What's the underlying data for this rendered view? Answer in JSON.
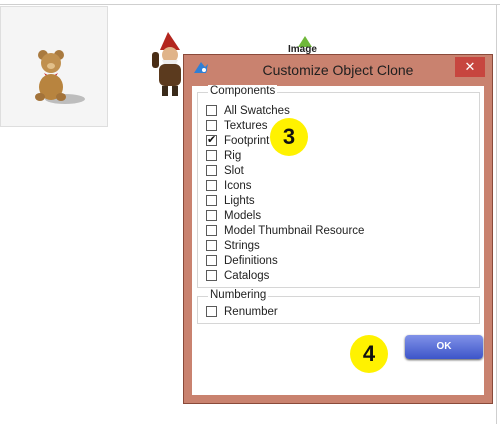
{
  "background": {
    "image_label": "Image"
  },
  "dialog": {
    "title": "Customize Object Clone",
    "close_label": "✕",
    "components": {
      "legend": "Components",
      "items": [
        {
          "label": "All Swatches",
          "checked": false
        },
        {
          "label": "Textures",
          "checked": false
        },
        {
          "label": "Footprint",
          "checked": true
        },
        {
          "label": "Rig",
          "checked": false
        },
        {
          "label": "Slot",
          "checked": false
        },
        {
          "label": "Icons",
          "checked": false
        },
        {
          "label": "Lights",
          "checked": false
        },
        {
          "label": "Models",
          "checked": false
        },
        {
          "label": "Model Thumbnail Resource",
          "checked": false
        },
        {
          "label": "Strings",
          "checked": false
        },
        {
          "label": "Definitions",
          "checked": false
        },
        {
          "label": "Catalogs",
          "checked": false
        }
      ]
    },
    "numbering": {
      "legend": "Numbering",
      "renumber_label": "Renumber",
      "renumber_checked": false
    },
    "ok_label": "OK"
  },
  "annotations": {
    "step_three": "3",
    "step_four": "4"
  },
  "colors": {
    "dialog_frame": "#c9826f",
    "close_button": "#c7463f",
    "ok_button": "#4a63d4",
    "annotation": "#fff200"
  }
}
